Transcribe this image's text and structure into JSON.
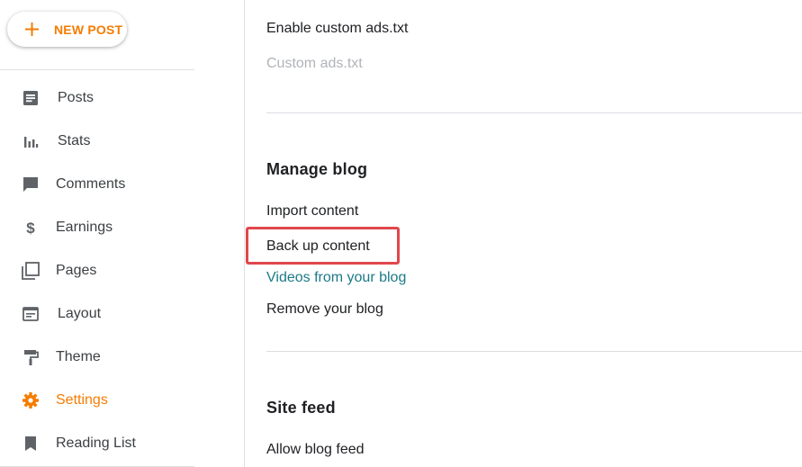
{
  "sidebar": {
    "new_post_label": "NEW POST",
    "accent_color": "#f57c00",
    "items": [
      {
        "label": "Posts",
        "icon": "posts-icon",
        "active": false
      },
      {
        "label": "Stats",
        "icon": "stats-icon",
        "active": false
      },
      {
        "label": "Comments",
        "icon": "comments-icon",
        "active": false
      },
      {
        "label": "Earnings",
        "icon": "dollar-icon",
        "active": false
      },
      {
        "label": "Pages",
        "icon": "pages-icon",
        "active": false
      },
      {
        "label": "Layout",
        "icon": "layout-icon",
        "active": false
      },
      {
        "label": "Theme",
        "icon": "paint-roller-icon",
        "active": false
      },
      {
        "label": "Settings",
        "icon": "gear-icon",
        "active": true
      },
      {
        "label": "Reading List",
        "icon": "bookmark-icon",
        "active": false
      }
    ]
  },
  "main": {
    "monetization": {
      "enable_custom_ads": "Enable custom ads.txt",
      "custom_ads": "Custom ads.txt"
    },
    "manage_blog": {
      "heading": "Manage blog",
      "import": "Import content",
      "backup": "Back up content",
      "videos": "Videos from your blog",
      "remove": "Remove your blog"
    },
    "site_feed": {
      "heading": "Site feed",
      "allow_feed": "Allow blog feed"
    },
    "highlight_color": "#e0474c"
  }
}
